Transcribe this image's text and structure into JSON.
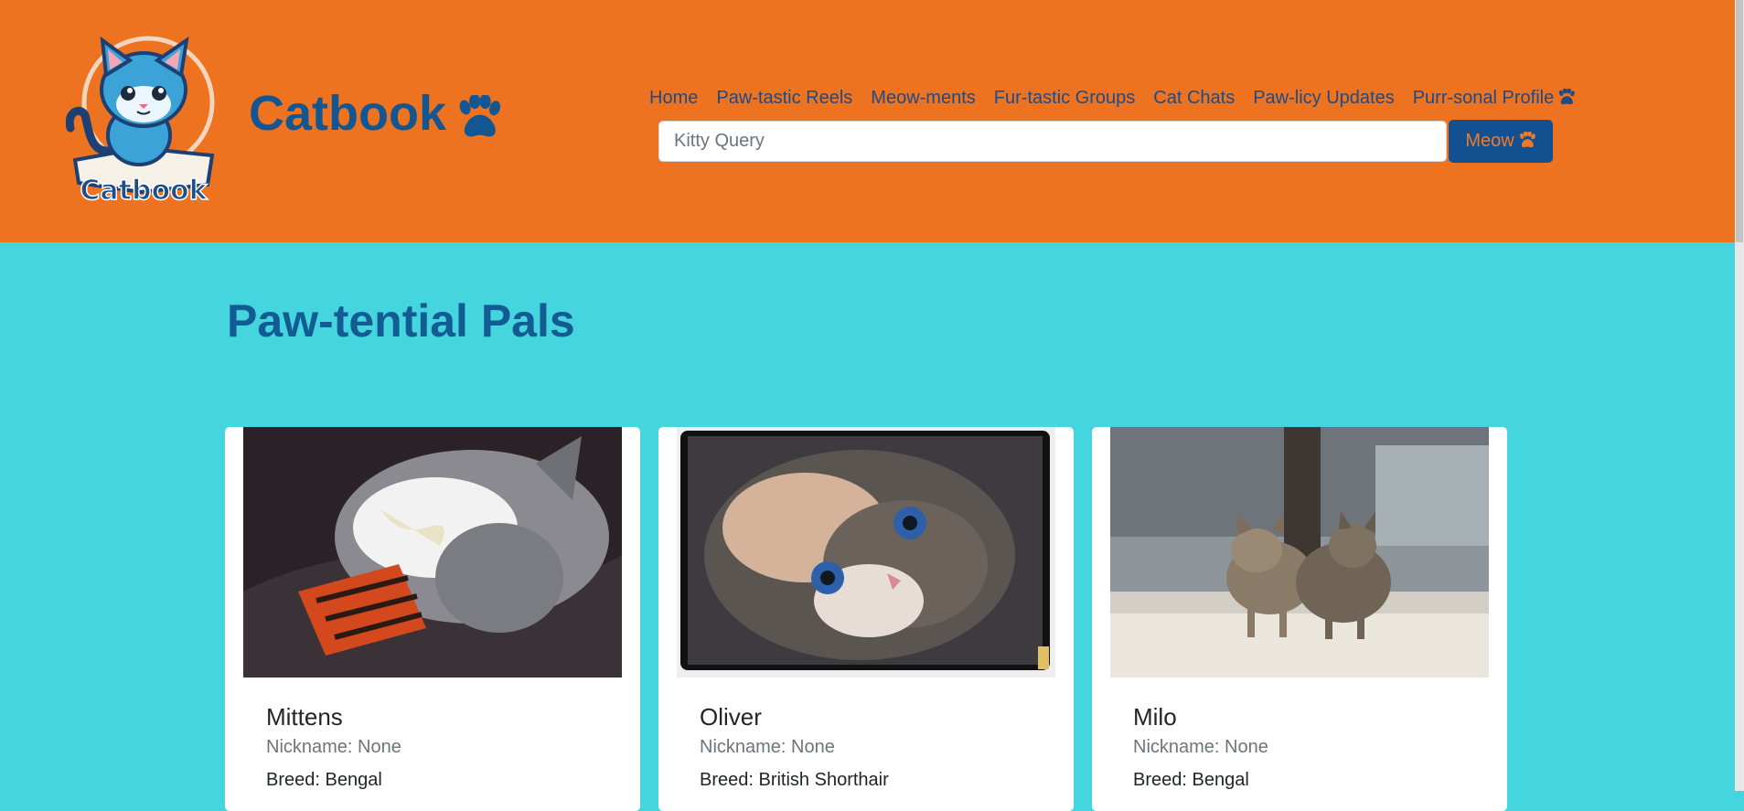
{
  "header": {
    "brand_name": "Catbook",
    "logo_text": "Catbook",
    "nav": [
      {
        "label": "Home"
      },
      {
        "label": "Paw-tastic Reels"
      },
      {
        "label": "Meow-ments"
      },
      {
        "label": "Fur-tastic Groups"
      },
      {
        "label": "Cat Chats"
      },
      {
        "label": "Paw-licy Updates"
      },
      {
        "label": "Purr-sonal Profile",
        "icon": "paw-icon"
      }
    ],
    "search": {
      "placeholder": "Kitty Query",
      "value": "",
      "button_label": "Meow",
      "button_icon": "paw-icon"
    }
  },
  "main": {
    "title": "Paw-tential Pals",
    "cards": [
      {
        "name": "Mittens",
        "nickname": "Nickname: None",
        "breed": "Breed: Bengal"
      },
      {
        "name": "Oliver",
        "nickname": "Nickname: None",
        "breed": "Breed: British Shorthair"
      },
      {
        "name": "Milo",
        "nickname": "Nickname: None",
        "breed": "Breed: Bengal"
      }
    ]
  },
  "colors": {
    "header_bg": "#ed7320",
    "page_bg": "#44d5df",
    "brand_blue": "#135692",
    "button_bg": "#13508f"
  }
}
